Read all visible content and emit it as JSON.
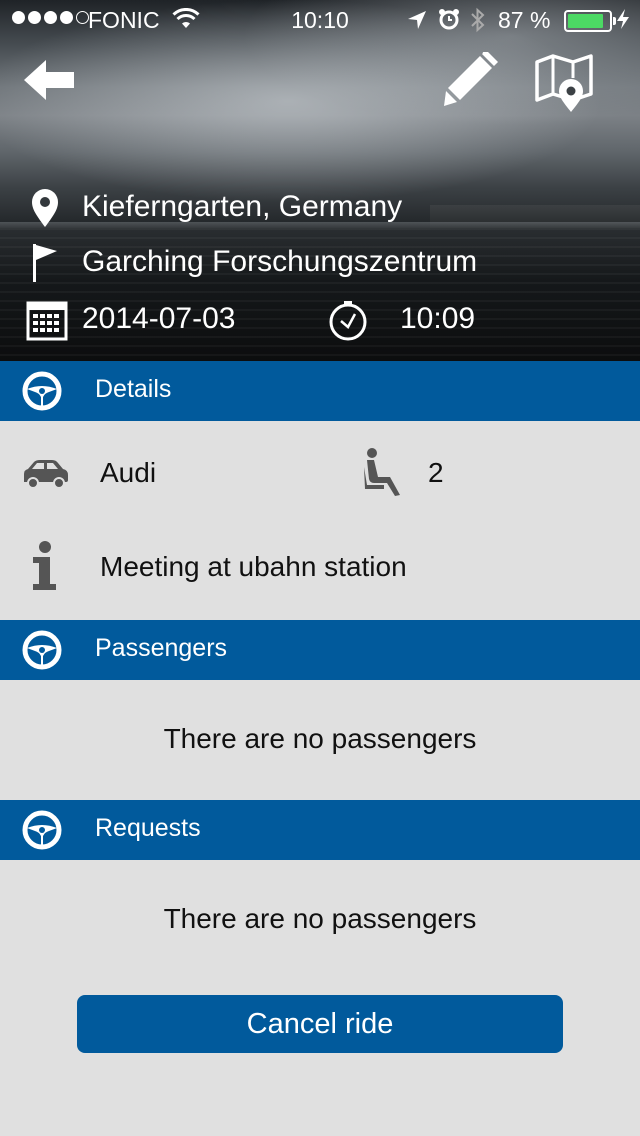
{
  "status_bar": {
    "carrier": "FONIC",
    "signal_bars_filled": 4,
    "signal_bars_total": 5,
    "time": "10:10",
    "battery_percent": "87 %",
    "battery_level": 0.87,
    "battery_color": "#4cd964"
  },
  "header": {
    "back_icon": "arrow-left-icon",
    "edit_icon": "pencil-icon",
    "map_icon": "map-pin-icon",
    "start_location": "Kieferngarten, Germany",
    "destination": "Garching Forschungszentrum",
    "date": "2014-07-03",
    "time": "10:09"
  },
  "sections": {
    "details": {
      "title": "Details"
    },
    "passengers": {
      "title": "Passengers",
      "empty_text": "There are no passengers"
    },
    "requests": {
      "title": "Requests",
      "empty_text": "There are no passengers"
    }
  },
  "details": {
    "car": "Audi",
    "seats": "2",
    "meeting_point": "Meeting at ubahn station"
  },
  "actions": {
    "cancel_label": "Cancel ride"
  },
  "colors": {
    "accent": "#015a9c",
    "background": "#e0e0e0",
    "icon_gray": "#555555"
  }
}
